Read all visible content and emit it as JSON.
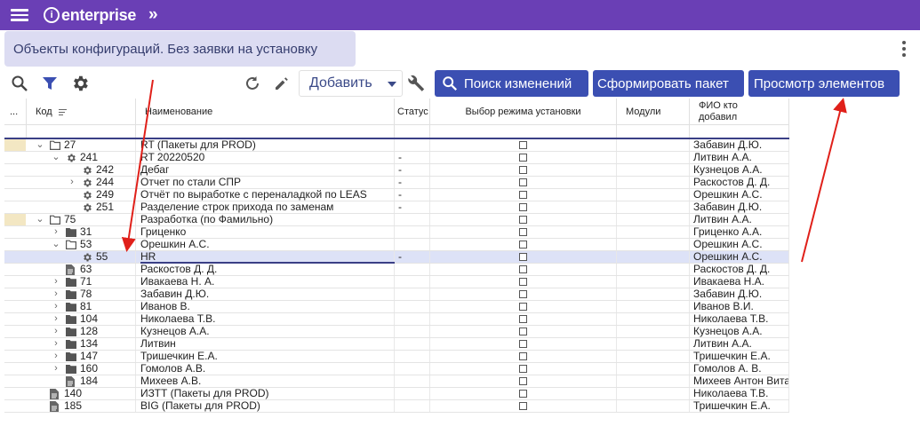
{
  "header": {
    "app_name": "enterprise"
  },
  "page": {
    "title": "Объекты конфигураций. Без заявки на установку"
  },
  "toolbar": {
    "add_label": "Добавить",
    "search_changes_label": "Поиск изменений",
    "build_package_label": "Сформировать пакет",
    "view_elements_label": "Просмотр элементов"
  },
  "columns": {
    "more": "...",
    "code": "Код",
    "name": "Наименование",
    "status": "Статус",
    "mode": "Выбор режима установки",
    "modules": "Модули",
    "fio": "ФИО кто добавил"
  },
  "rows": [
    {
      "marker": true,
      "indent": 0,
      "arrow": "down",
      "icon": "folder-open-icon",
      "code": "27",
      "name": "RT (Пакеты для PROD)",
      "status": "",
      "fio": "Забавин Д.Ю."
    },
    {
      "marker": false,
      "indent": 1,
      "arrow": "down",
      "icon": "gear-icon",
      "code": "241",
      "name": "RT 20220520",
      "status": "-",
      "fio": "Литвин А.А."
    },
    {
      "marker": false,
      "indent": 2,
      "arrow": "",
      "icon": "gear-icon",
      "code": "242",
      "name": "Дебаг",
      "status": "-",
      "fio": "Кузнецов А.А."
    },
    {
      "marker": false,
      "indent": 2,
      "arrow": "right",
      "icon": "gear-icon",
      "code": "244",
      "name": "Отчет по стали СПР",
      "status": "-",
      "fio": "Раскостов Д. Д."
    },
    {
      "marker": false,
      "indent": 2,
      "arrow": "",
      "icon": "gear-icon",
      "code": "249",
      "name": "Отчёт по выработке с переналадкой по LEAS",
      "status": "-",
      "fio": "Орешкин А.С."
    },
    {
      "marker": false,
      "indent": 2,
      "arrow": "",
      "icon": "gear-icon",
      "code": "251",
      "name": "Разделение строк прихода по заменам",
      "status": "-",
      "fio": "Забавин Д.Ю."
    },
    {
      "marker": true,
      "indent": 0,
      "arrow": "down",
      "icon": "folder-open-icon",
      "code": "75",
      "name": "Разработка (по Фамильно)",
      "status": "",
      "fio": "Литвин А.А."
    },
    {
      "marker": false,
      "indent": 1,
      "arrow": "right",
      "icon": "folder-icon",
      "code": "31",
      "name": "Гриценко",
      "status": "",
      "fio": "Гриценко А.А."
    },
    {
      "marker": false,
      "indent": 1,
      "arrow": "down",
      "icon": "folder-open-icon",
      "code": "53",
      "name": "Орешкин А.С.",
      "status": "",
      "fio": "Орешкин А.С."
    },
    {
      "marker": false,
      "indent": 2,
      "arrow": "",
      "icon": "gear-icon",
      "code": "55",
      "name": "HR",
      "status": "-",
      "fio": "Орешкин А.С.",
      "selected": true
    },
    {
      "marker": false,
      "indent": 1,
      "arrow": "",
      "icon": "document-icon",
      "code": "63",
      "name": "Раскостов Д. Д.",
      "status": "",
      "fio": "Раскостов Д. Д."
    },
    {
      "marker": false,
      "indent": 1,
      "arrow": "right",
      "icon": "folder-icon",
      "code": "71",
      "name": "Ивакаева Н. А.",
      "status": "",
      "fio": "Ивакаева Н.А."
    },
    {
      "marker": false,
      "indent": 1,
      "arrow": "right",
      "icon": "folder-icon",
      "code": "78",
      "name": "Забавин Д.Ю.",
      "status": "",
      "fio": "Забавин Д.Ю."
    },
    {
      "marker": false,
      "indent": 1,
      "arrow": "right",
      "icon": "folder-icon",
      "code": "81",
      "name": "Иванов В.",
      "status": "",
      "fio": "Иванов В.И."
    },
    {
      "marker": false,
      "indent": 1,
      "arrow": "right",
      "icon": "folder-icon",
      "code": "104",
      "name": "Николаева Т.В.",
      "status": "",
      "fio": "Николаева Т.В."
    },
    {
      "marker": false,
      "indent": 1,
      "arrow": "right",
      "icon": "folder-icon",
      "code": "128",
      "name": "Кузнецов А.А.",
      "status": "",
      "fio": "Кузнецов А.А."
    },
    {
      "marker": false,
      "indent": 1,
      "arrow": "right",
      "icon": "folder-icon",
      "code": "134",
      "name": "Литвин",
      "status": "",
      "fio": "Литвин А.А."
    },
    {
      "marker": false,
      "indent": 1,
      "arrow": "right",
      "icon": "folder-icon",
      "code": "147",
      "name": "Тришечкин Е.А.",
      "status": "",
      "fio": "Тришечкин Е.А."
    },
    {
      "marker": false,
      "indent": 1,
      "arrow": "right",
      "icon": "folder-icon",
      "code": "160",
      "name": "Гомолов А.В.",
      "status": "",
      "fio": "Гомолов А. В."
    },
    {
      "marker": false,
      "indent": 1,
      "arrow": "",
      "icon": "document-icon",
      "code": "184",
      "name": "Михеев А.В.",
      "status": "",
      "fio": "Михеев Антон Вита"
    },
    {
      "marker": false,
      "indent": 0,
      "arrow": "",
      "icon": "document-icon",
      "code": "140",
      "name": "ИЗТТ (Пакеты для PROD)",
      "status": "",
      "fio": "Николаева Т.В."
    },
    {
      "marker": false,
      "indent": 0,
      "arrow": "",
      "icon": "document-icon",
      "code": "185",
      "name": "BIG (Пакеты для PROD)",
      "status": "",
      "fio": "Тришечкин Е.А."
    }
  ],
  "colors": {
    "topbar": "#6a3fb5",
    "button": "#3b4fb2",
    "title_bg": "#dcdcf2",
    "marker": "#f3e7c3",
    "selected_row": "#dde2f7",
    "annotation": "#e0201a"
  }
}
